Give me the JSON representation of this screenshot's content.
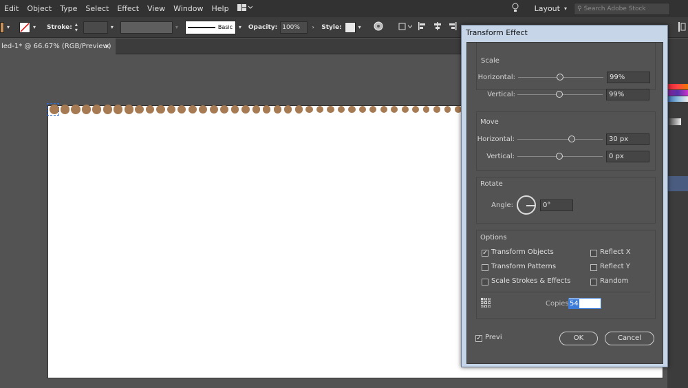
{
  "menubar": {
    "items": [
      "Edit",
      "Object",
      "Type",
      "Select",
      "Effect",
      "View",
      "Window",
      "Help"
    ],
    "workspace": "Layout",
    "search_placeholder": "Search Adobe Stock"
  },
  "controlbar": {
    "stroke_label": "Stroke:",
    "brush": "Basic",
    "opacity_label": "Opacity:",
    "opacity_value": "100%",
    "style_label": "Style:"
  },
  "document": {
    "tab_title": "led-1* @ 66.67% (RGB/Preview)",
    "close_glyph": "×",
    "dot_color": "#a67a52"
  },
  "dialog": {
    "title": "Transform Effect",
    "scale": {
      "title": "Scale",
      "horizontal_label": "Horizontal:",
      "horizontal_value": "99%",
      "vertical_label": "Vertical:",
      "vertical_value": "99%"
    },
    "move": {
      "title": "Move",
      "horizontal_label": "Horizontal:",
      "horizontal_value": "30 px",
      "vertical_label": "Vertical:",
      "vertical_value": "0 px"
    },
    "rotate": {
      "title": "Rotate",
      "angle_label": "Angle:",
      "angle_value": "0°"
    },
    "options": {
      "title": "Options",
      "transform_objects": "Transform Objects",
      "transform_patterns": "Transform Patterns",
      "scale_strokes": "Scale Strokes & Effects",
      "reflect_x": "Reflect X",
      "reflect_y": "Reflect Y",
      "random": "Random",
      "copies_label": "Copies",
      "copies_value": "54"
    },
    "preview_label": "Previ",
    "ok_label": "OK",
    "cancel_label": "Cancel"
  }
}
